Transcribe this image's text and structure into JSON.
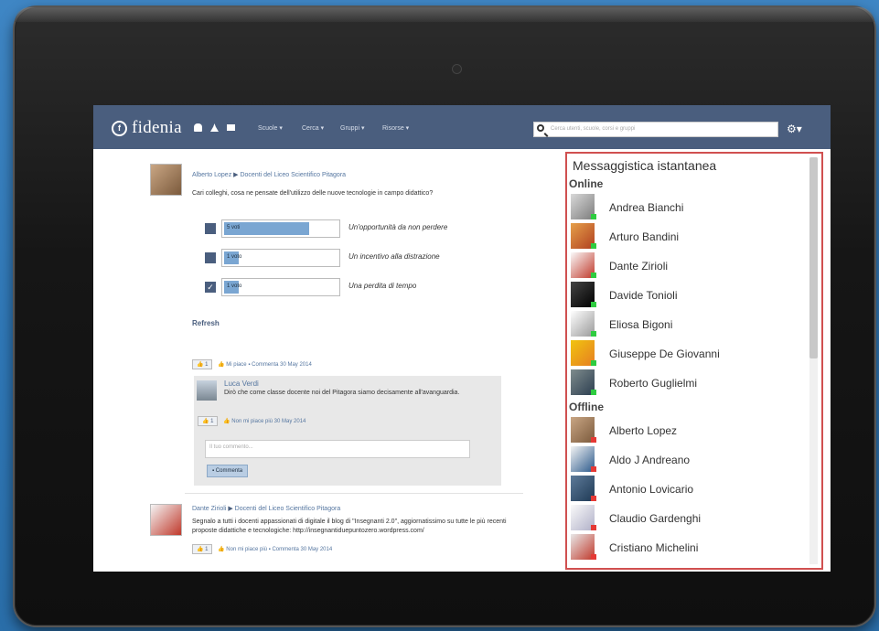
{
  "app": {
    "logo_text": "fidenia",
    "logo_mark": "f"
  },
  "nav": {
    "menus": [
      "Scuole ▾",
      "Cerca ▾",
      "Gruppi ▾",
      "Risorse ▾"
    ],
    "search_placeholder": "Cerca utenti, scuole, corsi e gruppi"
  },
  "feed": {
    "post1": {
      "author": "Alberto Lopez",
      "target": "Docenti del Liceo Scientifico Pitagora",
      "text": "Cari colleghi, cosa ne pensate dell'utilizzo delle nuove tecnologie in campo didattico?",
      "poll": [
        {
          "value": "5 voti",
          "fraction": 0.72,
          "label": "Un'opportunità da non perdere",
          "checked": false
        },
        {
          "value": "1 voto",
          "fraction": 0.12,
          "label": "Un incentivo alla distrazione",
          "checked": false
        },
        {
          "value": "1 voto",
          "fraction": 0.12,
          "label": "Una perdita di tempo",
          "checked": true
        }
      ],
      "refresh": "Refresh",
      "like_count": "1",
      "like_label": "Mi piace",
      "comment_label": "Commenta",
      "date": "30 May 2014"
    },
    "comment": {
      "author": "Luca Verdi",
      "text": "Dirò che come classe docente noi del Pitagora siamo decisamente all'avanguardia.",
      "like_count": "1",
      "like_label": "Non mi piace più",
      "date": "30 May 2014",
      "input_placeholder": "Il tuo commento...",
      "submit_label": "Commenta"
    },
    "post2": {
      "author": "Dante Zirioli",
      "target": "Docenti del Liceo Scientifico Pitagora",
      "text": "Segnalo a tutti i docenti appassionati di digitale il blog di \"Insegnanti 2.0\", aggiornatissimo su tutte le più recenti proposte didattiche e tecnologiche: http://insegnantiduepuntozero.wordpress.com/",
      "like_count": "1",
      "like_label": "Non mi piace più",
      "comment_label": "Commenta",
      "date": "30 May 2014"
    }
  },
  "chat": {
    "title": "Messaggistica istantanea",
    "online_label": "Online",
    "offline_label": "Offline",
    "online": [
      "Andrea Bianchi",
      "Arturo Bandini",
      "Dante Zirioli",
      "Davide Tonioli",
      "Eliosa Bigoni",
      "Giuseppe De Giovanni",
      "Roberto Guglielmi"
    ],
    "offline": [
      "Alberto Lopez",
      "Aldo J Andreano",
      "Antonio Lovicario",
      "Claudio Gardenghi",
      "Cristiano Michelini"
    ],
    "online_color": "#2ecc40",
    "offline_color": "#e53935"
  }
}
